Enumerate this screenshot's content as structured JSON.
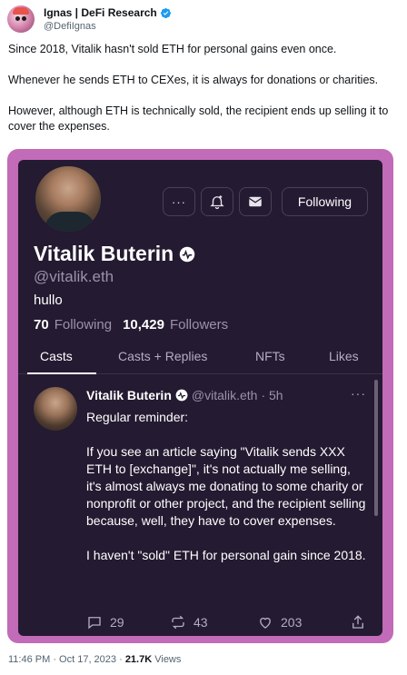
{
  "tweet": {
    "author_name": "Ignas | DeFi Research",
    "author_handle": "@DefiIgnas",
    "paragraphs": [
      "Since 2018, Vitalik hasn't sold ETH for personal gains even once.",
      "Whenever he sends ETH to CEXes, it is always for donations or charities.",
      "However, although ETH is technically sold, the recipient ends up selling it to cover the expenses."
    ],
    "time": "11:46 PM · Oct 17, 2023 ·",
    "views_count": "21.7K",
    "views_label": "Views"
  },
  "profile": {
    "display_name": "Vitalik Buterin",
    "username": "@vitalik.eth",
    "bio": "hullo",
    "following_count": "70",
    "following_label": "Following",
    "followers_count": "10,429",
    "followers_label": "Followers",
    "more_button": "···",
    "follow_button": "Following"
  },
  "tabs": [
    "Casts",
    "Casts + Replies",
    "NFTs",
    "Likes"
  ],
  "cast": {
    "author": "Vitalik Buterin",
    "handle": "@vitalik.eth",
    "time": "· 5h",
    "more": "···",
    "paragraphs": [
      "Regular reminder:",
      "If you see an article saying \"Vitalik sends XXX ETH to [exchange]\", it's not actually me selling, it's almost always me donating to some charity or nonprofit or other project, and the recipient selling because, well, they have to cover expenses.",
      "I haven't \"sold\" ETH for personal gain since 2018."
    ],
    "replies": "29",
    "recasts": "43",
    "likes": "203"
  },
  "colors": {
    "frame": "#c26bb8",
    "screen": "#241a31",
    "verified_blue": "#1d9bf0"
  },
  "icons": [
    "verified-badge-icon",
    "notification-bell-icon",
    "mail-icon",
    "reply-icon",
    "recast-icon",
    "heart-icon",
    "share-icon"
  ]
}
